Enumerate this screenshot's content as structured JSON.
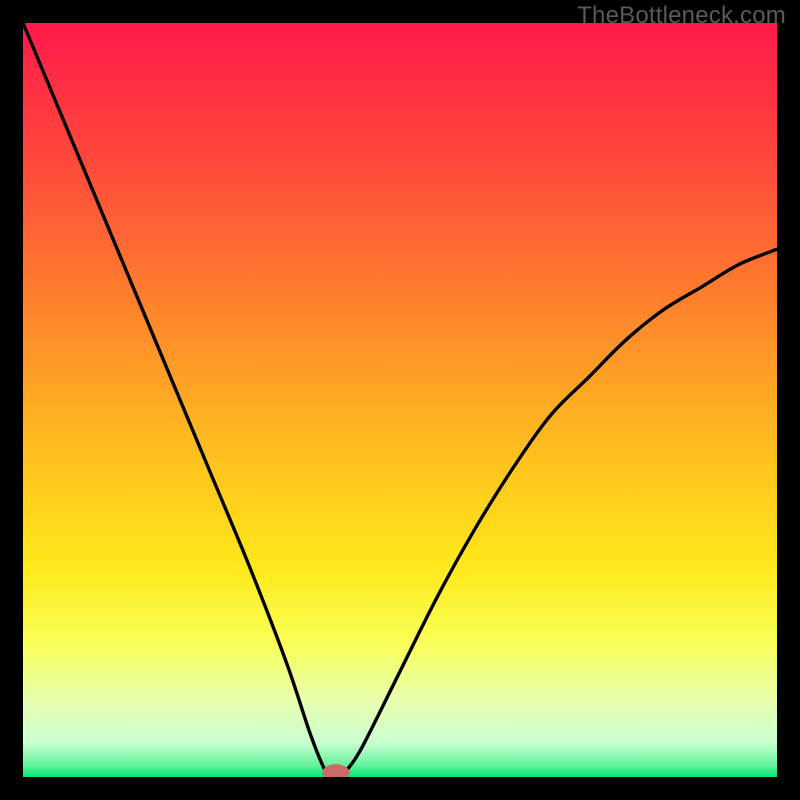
{
  "watermark": "TheBottleneck.com",
  "chart_data": {
    "type": "line",
    "title": "",
    "xlabel": "",
    "ylabel": "",
    "xlim": [
      0,
      100
    ],
    "ylim": [
      0,
      100
    ],
    "grid": false,
    "legend": false,
    "series": [
      {
        "name": "curve",
        "x": [
          0,
          5,
          10,
          15,
          20,
          25,
          30,
          35,
          38,
          40,
          41,
          42,
          43,
          45,
          50,
          55,
          60,
          65,
          70,
          75,
          80,
          85,
          90,
          95,
          100
        ],
        "y": [
          100,
          88,
          76,
          64,
          52,
          40,
          28,
          15,
          6,
          1,
          0,
          0,
          1,
          4,
          14,
          24,
          33,
          41,
          48,
          53,
          58,
          62,
          65,
          68,
          70
        ]
      }
    ],
    "background": {
      "type": "vertical-gradient",
      "stops": [
        {
          "pos": 0.0,
          "color": "#ff1a4a"
        },
        {
          "pos": 0.2,
          "color": "#ff4d3a"
        },
        {
          "pos": 0.4,
          "color": "#ff8a2a"
        },
        {
          "pos": 0.58,
          "color": "#ffc21e"
        },
        {
          "pos": 0.72,
          "color": "#ffe81a"
        },
        {
          "pos": 0.82,
          "color": "#f9ff55"
        },
        {
          "pos": 0.9,
          "color": "#e8ffb0"
        },
        {
          "pos": 0.955,
          "color": "#c9ffd0"
        },
        {
          "pos": 0.985,
          "color": "#61f29a"
        },
        {
          "pos": 1.0,
          "color": "#00e573"
        }
      ]
    },
    "marker": {
      "x": 41.5,
      "y": 0,
      "rx": 1.8,
      "ry": 1.1,
      "color": "#cc6a6a"
    }
  }
}
